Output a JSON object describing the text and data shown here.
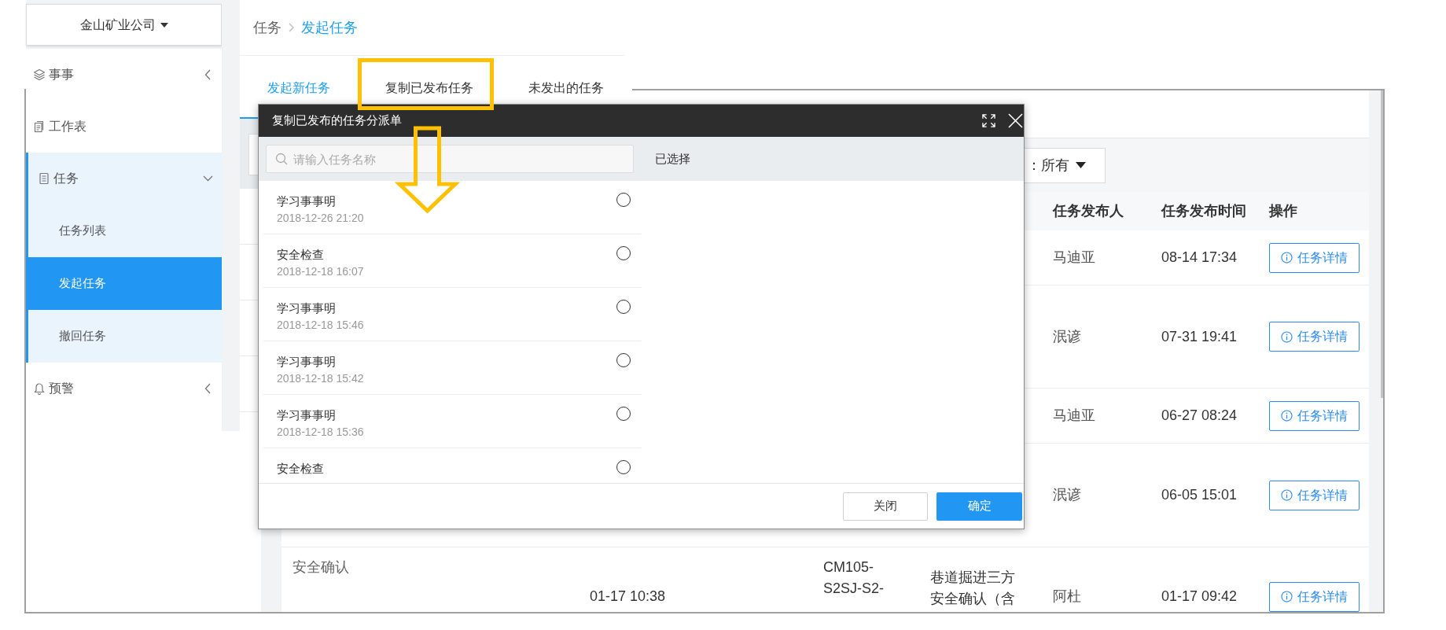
{
  "sidebar": {
    "company": "金山矿业公司",
    "items": [
      {
        "label": "事事",
        "expanded": false
      },
      {
        "label": "工作表"
      },
      {
        "label": "任务",
        "expanded": true,
        "children": [
          {
            "label": "任务列表",
            "selected": false
          },
          {
            "label": "发起任务",
            "selected": true
          },
          {
            "label": "撤回任务",
            "selected": false
          }
        ]
      },
      {
        "label": "预警",
        "expanded": false
      }
    ]
  },
  "breadcrumb": [
    {
      "label": "任务",
      "current": false
    },
    {
      "label": "发起任务",
      "current": true
    }
  ],
  "tabs": [
    {
      "label": "发起新任务",
      "selected": true,
      "highlighted": false
    },
    {
      "label": "复制已发布任务",
      "selected": false,
      "highlighted": true
    },
    {
      "label": "未发出的任务",
      "selected": false,
      "highlighted": false
    }
  ],
  "task_table": {
    "filter": {
      "value": "：所有"
    },
    "columns": [
      "任务发布人",
      "任务发布时间",
      "操作"
    ],
    "rows": [
      {
        "publisher": "马迪亚",
        "publish_time": "08-14 17:34",
        "action": "任务详情"
      },
      {
        "publisher": "泯谚",
        "publish_time": "07-31 19:41",
        "action": "任务详情"
      },
      {
        "publisher": "马迪亚",
        "publish_time": "06-27 08:24",
        "action": "任务详情"
      },
      {
        "publisher": "泯谚",
        "publish_time": "06-05 15:01",
        "action": "任务详情"
      },
      {
        "column_1": "安全确认",
        "column_2": "01-17 10:38",
        "column_3": "CM105-S2SJ-S2-",
        "column_4": "巷道掘进三方安全确认（含",
        "publisher": "阿杜",
        "publish_time": "01-17 09:42",
        "action": "任务详情"
      }
    ]
  },
  "dialog": {
    "title": "复制已发布的任务分派单",
    "search": {
      "placeholder": "请输入任务名称"
    },
    "selected_heading": "已选择",
    "items": [
      {
        "title": "学习事事明",
        "date": "2018-12-26 21:20",
        "selected": false
      },
      {
        "title": "安全检查",
        "date": "2018-12-18 16:07",
        "selected": false
      },
      {
        "title": "学习事事明",
        "date": "2018-12-18 15:46",
        "selected": false
      },
      {
        "title": "学习事事明",
        "date": "2018-12-18 15:42",
        "selected": false
      },
      {
        "title": "学习事事明",
        "date": "2018-12-18 15:36",
        "selected": false
      },
      {
        "title": "安全检查",
        "selected": false
      }
    ],
    "buttons": [
      {
        "label": "关闭",
        "kind": "secondary"
      },
      {
        "label": "确定",
        "kind": "primary"
      }
    ]
  }
}
